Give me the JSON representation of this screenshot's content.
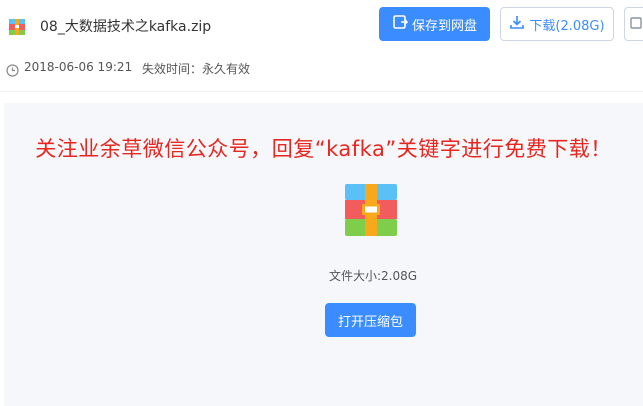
{
  "file": {
    "name": "08_大数据技术之kafka.zip",
    "date": "2018-06-06 19:21",
    "expire_label": "失效时间：",
    "expire_value": "永久有效",
    "size_label": "文件大小:",
    "size_value": "2.08G"
  },
  "toolbar": {
    "save_label": "保存到网盘",
    "download_label": "下载(2.08G)"
  },
  "notice": "关注业余草微信公众号，回复“kafka”关键字进行免费下载！",
  "actions": {
    "open_label": "打开压缩包"
  },
  "colors": {
    "primary": "#3b8cff",
    "notice": "#e8251f",
    "panel_bg": "#f5f7fb"
  },
  "icons": [
    "zip-file-icon",
    "save-to-cloud-icon",
    "download-icon",
    "clock-icon",
    "more-icon"
  ]
}
